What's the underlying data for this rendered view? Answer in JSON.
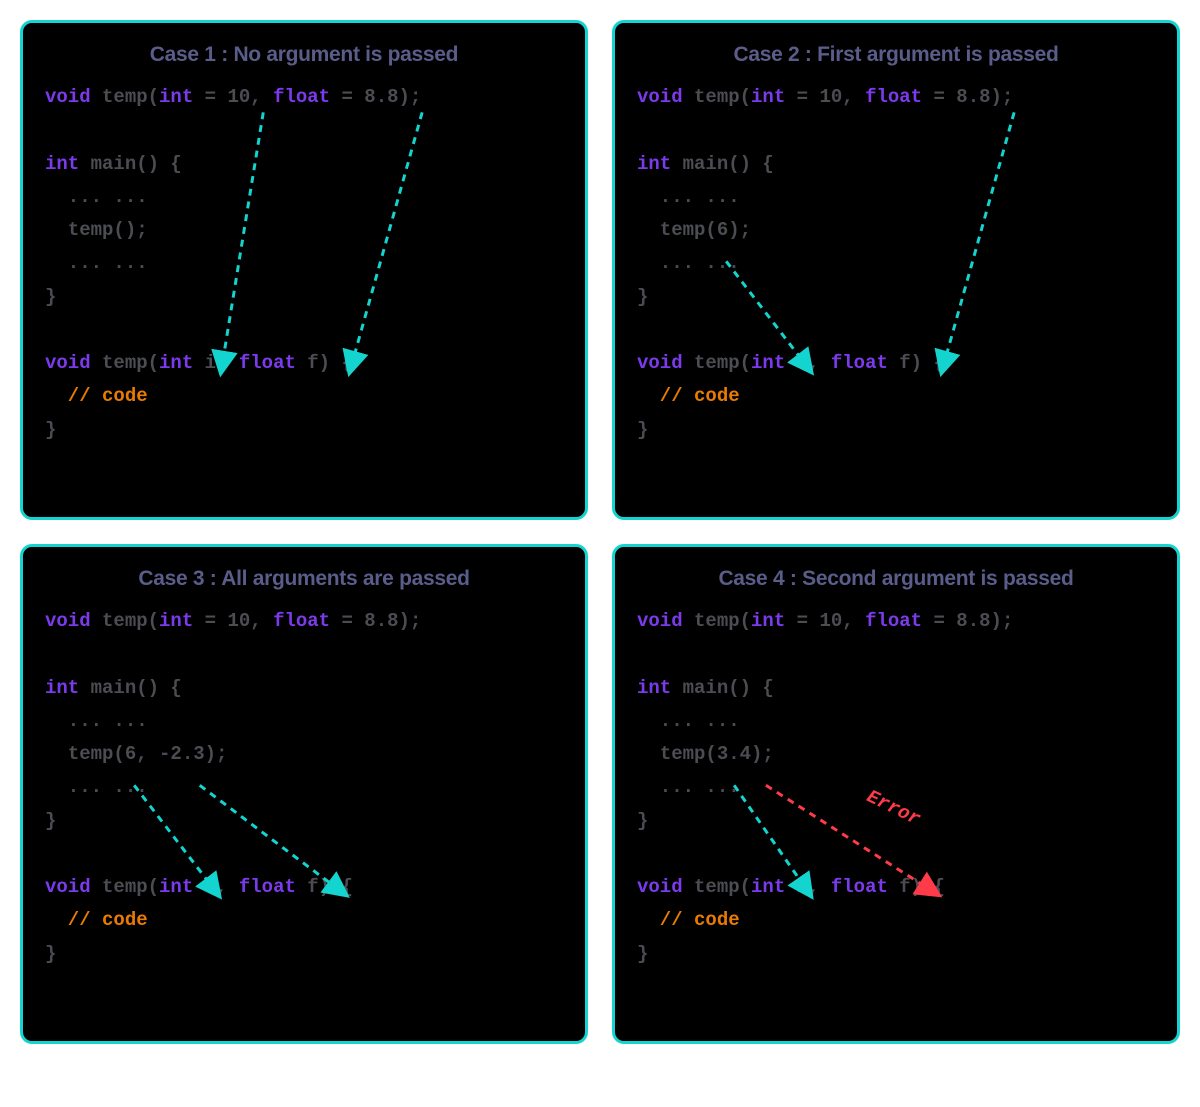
{
  "colors": {
    "panelBorder": "#14d4cf",
    "panelBg": "#000000",
    "titleText": "#5a5c8a",
    "keyword": "#7c3aed",
    "dim": "#4b4d53",
    "comment": "#e87b00",
    "arrow": "#14d4cf",
    "error": "#ff3b4a"
  },
  "panels": {
    "case1": {
      "title": "Case 1 : No argument is passed",
      "call": "temp();",
      "errorLabel": null
    },
    "case2": {
      "title": "Case 2 : First argument is passed",
      "call": "temp(6);",
      "errorLabel": null
    },
    "case3": {
      "title": "Case 3 : All arguments are passed",
      "call": "temp(6, -2.3);",
      "errorLabel": null
    },
    "case4": {
      "title": "Case 4 : Second argument is passed",
      "call": "temp(3.4);",
      "errorLabel": "Error"
    }
  },
  "code": {
    "void": "void",
    "int": "int",
    "float": "float",
    "fn": " temp(",
    "eq10": " = 10, ",
    "eq88": " = 8.8);",
    "main": " main() {",
    "dots": "  ... ...",
    "callIndent": "  ",
    "close": "}",
    "defTail": " i, ",
    "defTail2": " f) {",
    "comment": "  // code"
  }
}
